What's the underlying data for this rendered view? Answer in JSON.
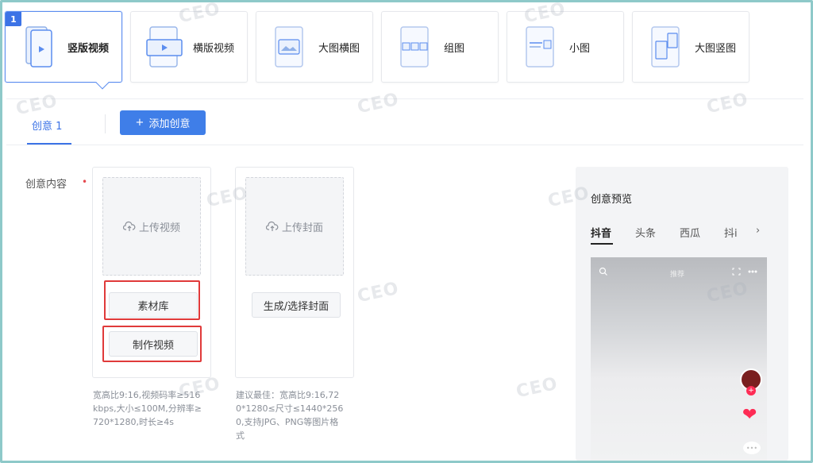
{
  "types": [
    {
      "label": "竖版视频",
      "badge": "1",
      "selected": true,
      "icon": "vertical-video-icon"
    },
    {
      "label": "横版视频",
      "selected": false,
      "icon": "horizontal-video-icon"
    },
    {
      "label": "大图横图",
      "selected": false,
      "icon": "large-horizontal-image-icon"
    },
    {
      "label": "组图",
      "selected": false,
      "icon": "image-group-icon"
    },
    {
      "label": "小图",
      "selected": false,
      "icon": "small-image-icon"
    },
    {
      "label": "大图竖图",
      "selected": false,
      "icon": "large-vertical-image-icon"
    }
  ],
  "tabs": {
    "creative_tab": "创意 1",
    "add_button": "添加创意",
    "add_icon": "+"
  },
  "content": {
    "label": "创意内容",
    "required_mark": "•",
    "video_panel": {
      "upload_label": "上传视频",
      "library_button": "素材库",
      "make_button": "制作视频",
      "hint_lines": [
        "宽高比9:16,视频码率≥516",
        "kbps,大小≤100M,分辨率≥",
        "720*1280,时长≥4s"
      ]
    },
    "cover_panel": {
      "upload_label": "上传封面",
      "select_button": "生成/选择封面",
      "hint_lines": [
        "建议最佳：宽高比9:16,72",
        "0*1280≤尺寸≤1440*256",
        "0,支持JPG、PNG等图片格",
        "式"
      ]
    }
  },
  "preview": {
    "title": "创意预览",
    "tabs": [
      "抖音",
      "头条",
      "西瓜",
      "抖i"
    ],
    "active_tab": 0,
    "phone_title": "推荐"
  },
  "colors": {
    "accent": "#3f7ee8",
    "highlight": "#e03a3a",
    "badge": "#3c73e6"
  }
}
